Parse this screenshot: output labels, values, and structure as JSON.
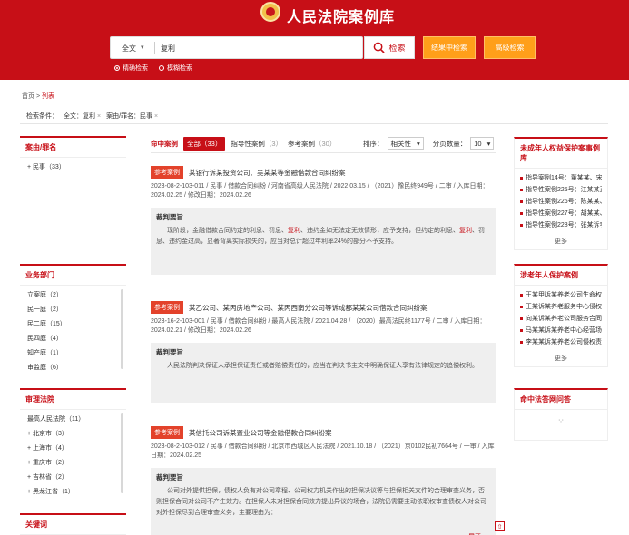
{
  "header": {
    "site_title": "人民法院案例库",
    "search_scope": "全文",
    "search_value": "复利",
    "search_button": "检索",
    "within_button": "结果中检索",
    "advanced_button": "高级检索",
    "mode_precise": "精确检索",
    "mode_fuzzy": "模糊检索"
  },
  "breadcrumb": {
    "home": "首页",
    "sep": ">",
    "current": "列表"
  },
  "filters": {
    "label": "检索条件：",
    "conditions": [
      "全文：复利",
      "案由/罪名：民事"
    ]
  },
  "left": {
    "cause": {
      "title": "案由/罪名",
      "items": [
        "+ 民事（33）"
      ]
    },
    "dept": {
      "title": "业务部门",
      "items": [
        "立案庭（2）",
        "民一庭（2）",
        "民二庭（15）",
        "民四庭（4）",
        "知产庭（1）",
        "审监庭（6）"
      ]
    },
    "court": {
      "title": "审理法院",
      "items": [
        "最高人民法院（11）",
        "+ 北京市（3）",
        "+ 上海市（4）",
        "+ 重庆市（2）",
        "+ 吉林省（2）",
        "+ 黑龙江省（1）"
      ]
    },
    "keyword": {
      "title": "关键词"
    }
  },
  "main": {
    "tabs": {
      "hit": "命中案例",
      "all": "全部（33）",
      "guiding": "指导性案例",
      "guiding_n": "（3）",
      "reference": "参考案例",
      "reference_n": "（30）"
    },
    "sort_label": "排序：",
    "sort_value": "相关性",
    "page_label": "分页数量：",
    "page_value": "10",
    "cases": [
      {
        "badge": "参考案例",
        "title": "某银行诉某投资公司、吴某某等金融借款合同纠纷案",
        "meta": "2023-08-2-103-011 / 民事 / 借款合同纠纷 / 河南省高级人民法院 / 2022.03.15 / （2021）豫民终949号 / 二审 / 入库日期：2024.02.25 / 修改日期：2024.02.26",
        "box_title": "裁判要旨",
        "text_a": "现阶段，金融借款合同约定的利息、罚息、",
        "hl1": "复利",
        "text_b": "、违约金如无法定无效情形，应予支持，但约定的利息、",
        "hl2": "复利",
        "text_c": "、罚息、违约金过高，显著背离实际损失的，应当对总计超过年利率24%的部分不予支持。",
        "expand": ""
      },
      {
        "badge": "参考案例",
        "title": "某乙公司、某丙房地产公司、某丙西南分公司等诉成都某某公司借款合同纠纷案",
        "meta": "2023-16-2-103-001 / 民事 / 借款合同纠纷 / 最高人民法院 / 2021.04.28 / （2020）最高法民终1177号 / 二审 / 入库日期：2024.02.21 / 修改日期：2024.02.26",
        "box_title": "裁判要旨",
        "text": "人民法院判决保证人承担保证责任或者赔偿责任的，应当在判决书主文中明确保证人享有法律规定的追偿权利。",
        "expand": ""
      },
      {
        "badge": "参考案例",
        "title": "某信托公司诉某置业公司等金融借款合同纠纷案",
        "meta": "2023-08-2-103-012 / 民事 / 借款合同纠纷 / 北京市西城区人民法院 / 2021.10.18 / （2021）京0102民初7664号 / 一审 / 入库日期：2024.02.25",
        "box_title": "裁判要旨",
        "text": "公司对外提供担保，债权人负有对公司章程、公司权力机关作出的担保决议等与担保相关文件的合理审查义务，否则担保合同对公司不产生效力。在担保人未对担保合同效力提出异议的场合，法院仍需要主动依职权审查债权人对公司对外担保尽到合理审查义务，主要理由为：",
        "expand": "展开"
      }
    ]
  },
  "right": {
    "minors": {
      "title": "未成年人权益保护案事例库",
      "items": [
        "指导案例14号：董某某、宋某",
        "指导性案例225号：江某某正",
        "指导性案例226号：陈某某、",
        "指导性案例227号：胡某某、",
        "指导性案例228号：张某诉李"
      ],
      "more": "更多"
    },
    "elderly": {
      "title": "涉老年人保护案例",
      "items": [
        "王某甲诉某养老公司生命权纠",
        "王某诉某养老服务中心侵权纠纷案",
        "向某诉某养老公司服务合同纠",
        "马某某诉某养老中心经营场所",
        "李某某诉某养老公司侵权责任纠"
      ],
      "more": "更多"
    },
    "qa": {
      "title": "命中法答网问答",
      "loading": "⁙"
    }
  },
  "scroll_top": "⇧",
  "colors": {
    "brand_red": "#c70f17",
    "orange": "#ff9f1a",
    "badge_red": "#e3422b"
  }
}
